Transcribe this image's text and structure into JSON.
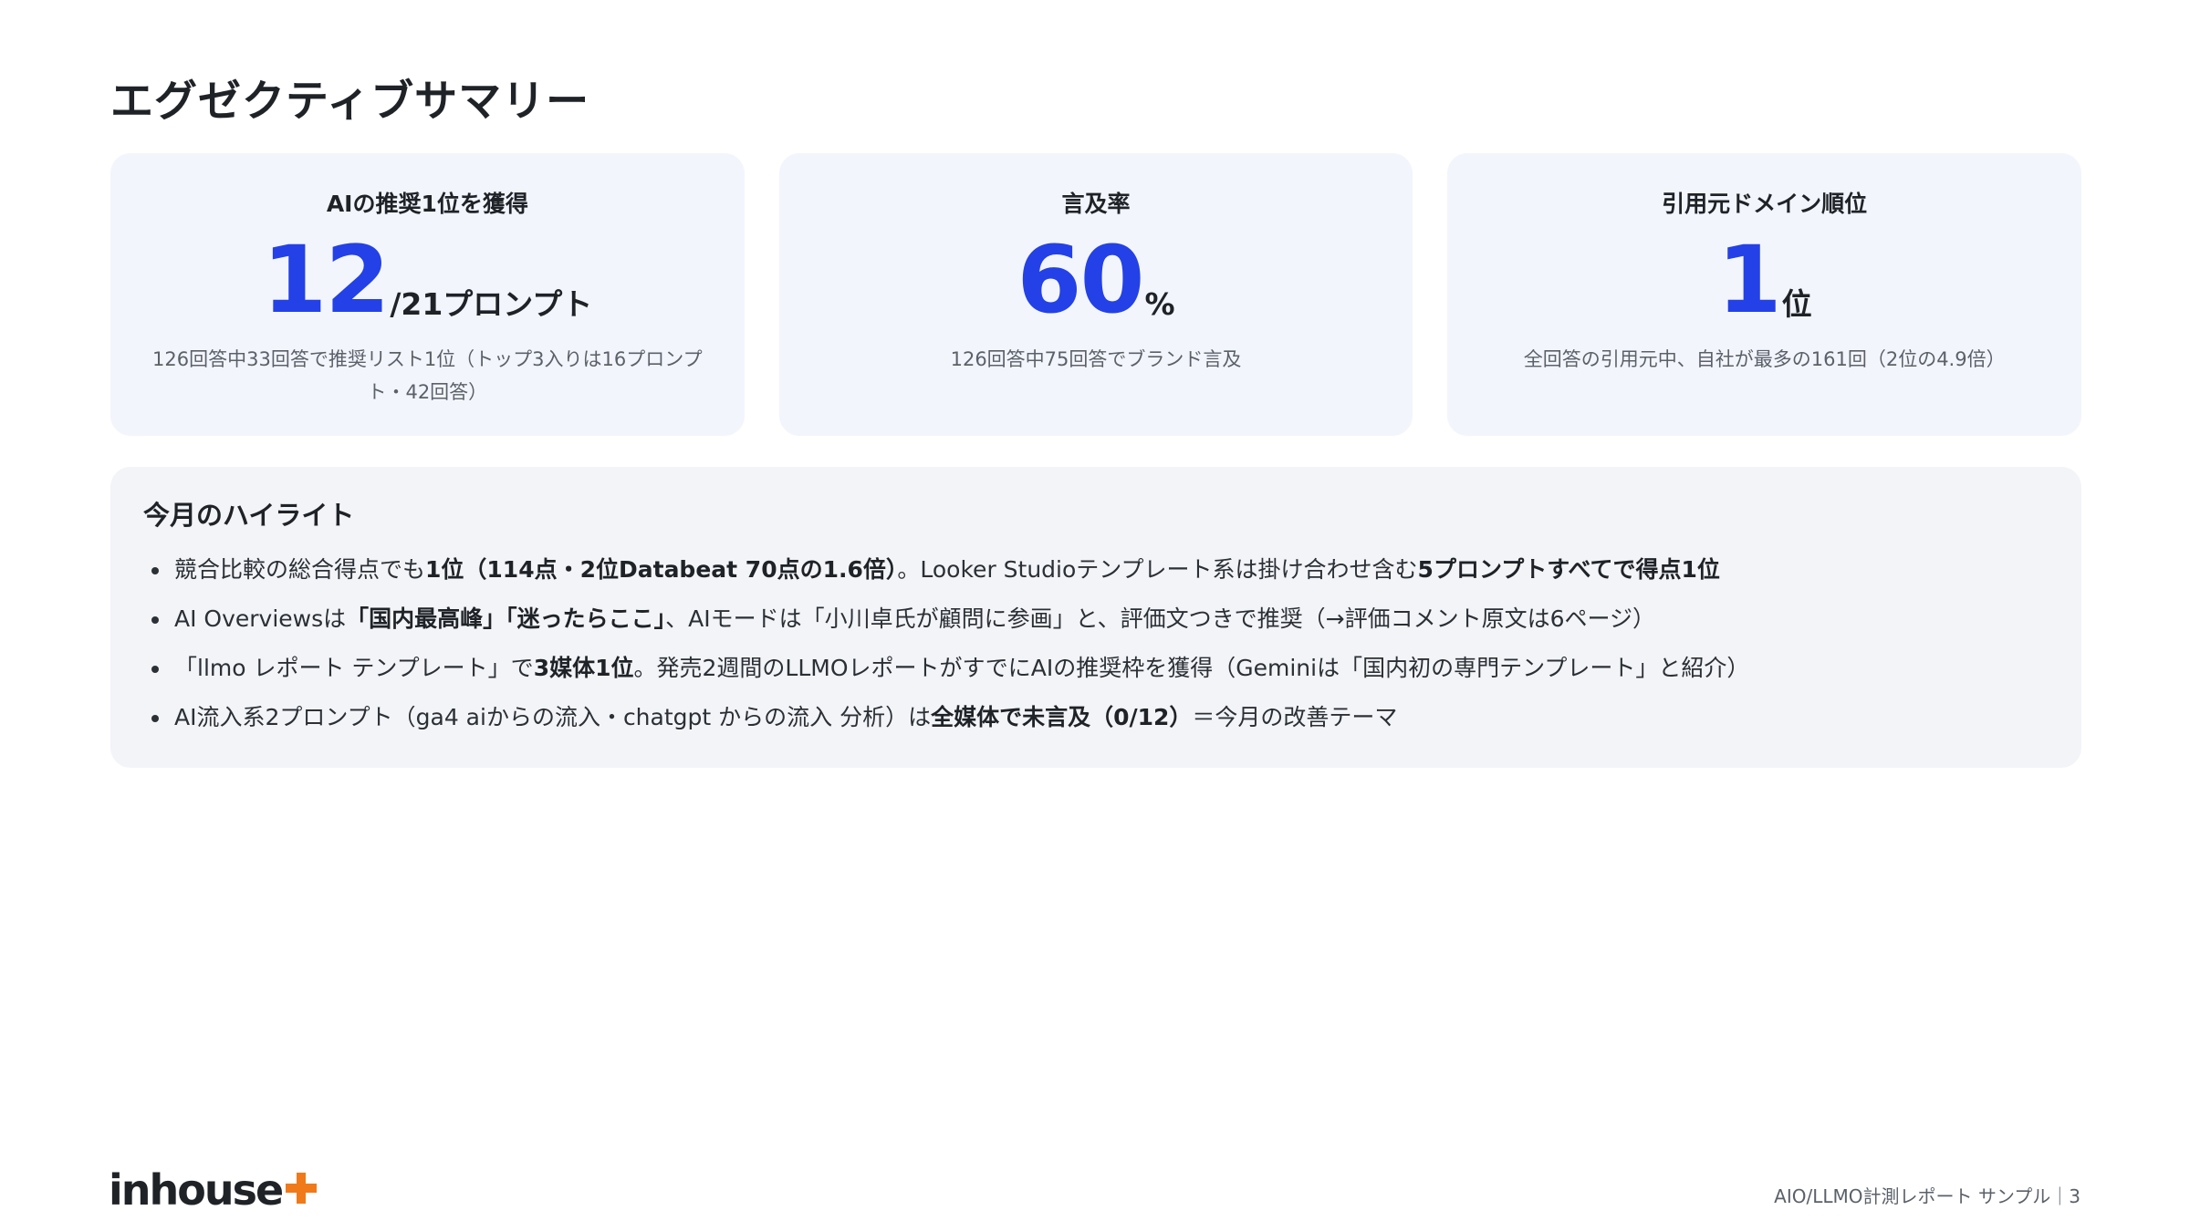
{
  "page": {
    "title": "エグゼクティブサマリー"
  },
  "kpis": [
    {
      "title": "AIの推奨1位を獲得",
      "value": "12",
      "unit": "/21プロンプト",
      "note": "126回答中33回答で推奨リスト1位（トップ3入りは16プロンプト・42回答）"
    },
    {
      "title": "言及率",
      "value": "60",
      "unit": "%",
      "note": "126回答中75回答でブランド言及"
    },
    {
      "title": "引用元ドメイン順位",
      "value": "1",
      "unit": "位",
      "note": "全回答の引用元中、自社が最多の161回（2位の4.9倍）"
    }
  ],
  "highlights": {
    "title": "今月のハイライト",
    "items": [
      {
        "parts": [
          {
            "text": "競合比較の総合得点でも",
            "bold": false
          },
          {
            "text": "1位（114点・2位Databeat 70点の1.6倍）",
            "bold": true
          },
          {
            "text": "。Looker Studioテンプレート系は掛け合わせ含む",
            "bold": false
          },
          {
            "text": "5プロンプトすべてで得点1位",
            "bold": true
          }
        ]
      },
      {
        "parts": [
          {
            "text": "AI Overviewsは",
            "bold": false
          },
          {
            "text": "「国内最高峰」「迷ったらここ」",
            "bold": true
          },
          {
            "text": "、AIモードは「小川卓氏が顧問に参画」と、評価文つきで推奨（→評価コメント原文は6ページ）",
            "bold": false
          }
        ]
      },
      {
        "parts": [
          {
            "text": "「llmo レポート テンプレート」で",
            "bold": false
          },
          {
            "text": "3媒体1位",
            "bold": true
          },
          {
            "text": "。発売2週間のLLMOレポートがすでにAIの推奨枠を獲得（Geminiは「国内初の専門テンプレート」と紹介）",
            "bold": false
          }
        ]
      },
      {
        "parts": [
          {
            "text": "AI流入系2プロンプト（ga4 aiからの流入・chatgpt からの流入 分析）は",
            "bold": false
          },
          {
            "text": "全媒体で未言及（0/12）",
            "bold": true
          },
          {
            "text": "＝今月の改善テーマ",
            "bold": false
          }
        ]
      }
    ]
  },
  "brand": {
    "logo_text": "inhouse",
    "accent_color": "#f07a1a"
  },
  "footer": {
    "text": "AIO/LLMO計測レポート サンプル｜3"
  },
  "colors": {
    "accent": "#2341e6",
    "card_bg": "#f3f5fd",
    "panel_bg": "#f3f4f8"
  }
}
